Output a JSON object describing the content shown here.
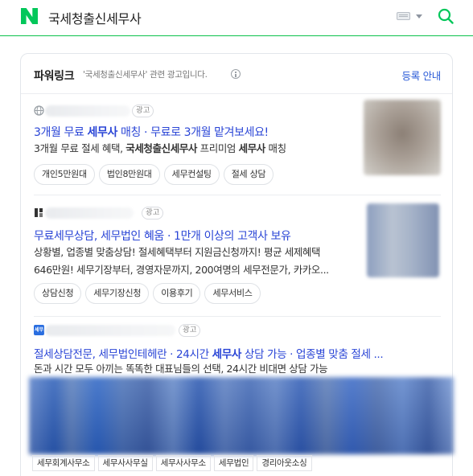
{
  "header": {
    "query": "국세청출신세무사",
    "brand_color": "#03c75a",
    "icons": [
      "naver-logo",
      "keyboard-icon",
      "caret-down-icon",
      "search-icon"
    ]
  },
  "panel": {
    "title": "파워링크",
    "note": "'국세청출신세무사' 관련 광고입니다.",
    "register_label": "등록 안내",
    "ad_label": "광고"
  },
  "ads": [
    {
      "title_pre": "3개월 무료 ",
      "title_bold": "세무사",
      "title_post": " 매칭 · 무료로 3개월 맡겨보세요!",
      "desc_pre": "3개월 무료 절세 혜택, ",
      "desc_bold1": "국세청출신세무사",
      "desc_mid": " 프리미엄 ",
      "desc_bold2": "세무사",
      "desc_post": " 매칭",
      "chips": [
        "개인5만원대",
        "법인8만원대",
        "세무컨설팅",
        "절세 상담"
      ]
    },
    {
      "title": "무료세무상담, 세무법인 혜움 · 1만개 이상의 고객사 보유",
      "desc_line1": "상황별, 업종별 맞춤상담! 절세혜택부터 지원금신청까지! 평균 세제혜택",
      "desc_line2": "646만원! 세무기장부터, 경영자문까지, 200여명의 세무전문가, 카카오...",
      "chips": [
        "상담신청",
        "세무기장신청",
        "이용후기",
        "세무서비스"
      ]
    },
    {
      "favicon_text": "세무",
      "title_pre": "절세상담전문, 세무법인테헤란 · 24시간 ",
      "title_bold": "세무사",
      "title_post": " 상담 가능 · 업종별 맞춤 절세 ...",
      "desc": "돈과 시간 모두 아끼는 똑똑한 대표님들의 선택, 24시간 비대면 상담 가능",
      "tags": [
        "세무회계사무소",
        "세무사사무실",
        "세무사사무소",
        "세무법인",
        "경리아웃소싱"
      ]
    }
  ],
  "colors": {
    "link": "#2a45d6",
    "accent_link": "#2a5bd7",
    "banner": "#3b64b8"
  }
}
